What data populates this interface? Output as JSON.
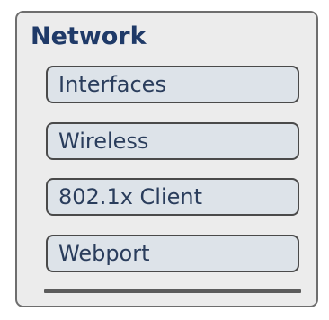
{
  "network_panel": {
    "title": "Network",
    "items": [
      {
        "label": "Interfaces"
      },
      {
        "label": "Wireless"
      },
      {
        "label": "802.1x Client"
      },
      {
        "label": "Webport"
      }
    ]
  },
  "colors": {
    "title_text": "#1f3a68",
    "item_background": "#dde3e9",
    "item_border": "#4a4a4a",
    "panel_background": "#ececec"
  }
}
